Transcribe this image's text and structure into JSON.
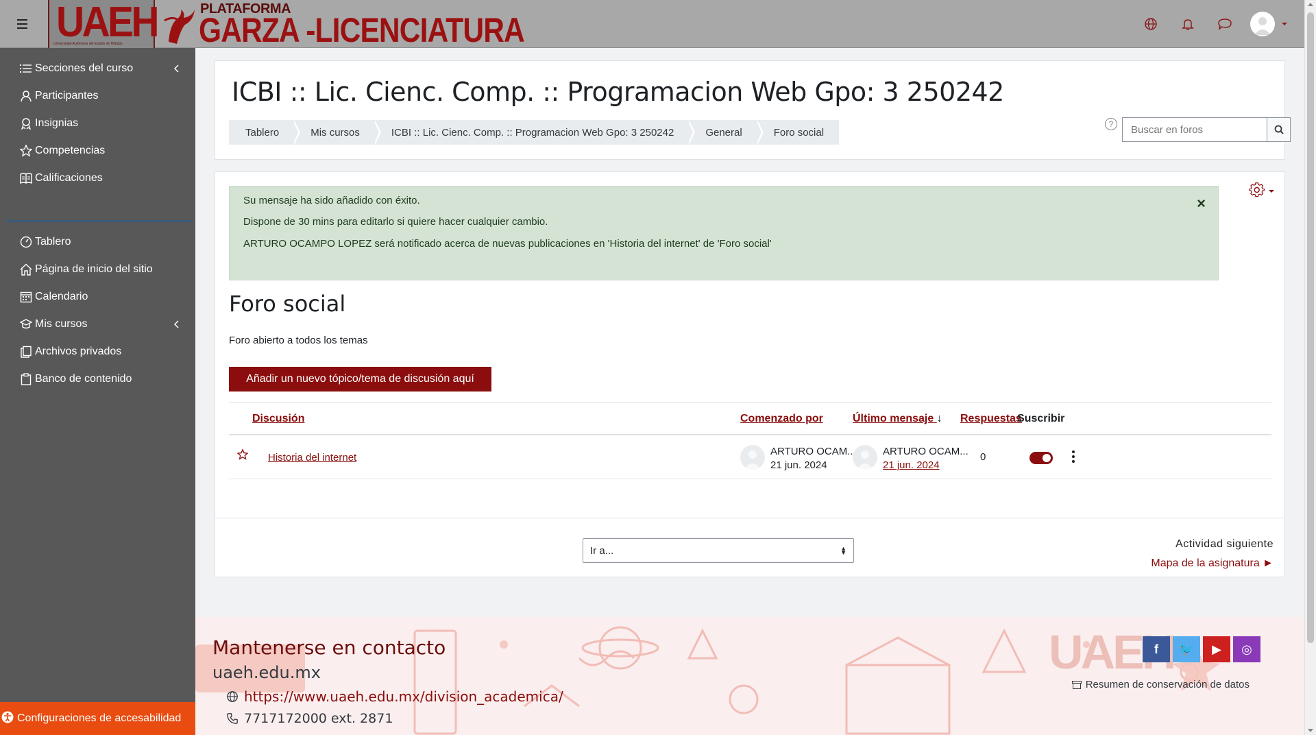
{
  "navbar": {
    "logo_uaeh": "UAEH",
    "logo_uaeh_sub": "Universidad Autónoma del Estado de Hidalgo",
    "logo_platform": "PLATAFORMA",
    "logo_garza": "GARZA -LICENCIATURA",
    "icons": [
      "hamburger-icon",
      "globe-icon",
      "bell-icon",
      "chat-icon",
      "user-avatar"
    ]
  },
  "sidebar": {
    "items": [
      {
        "label": "Secciones del curso",
        "icon": "list-icon",
        "has_chevron": true
      },
      {
        "label": "Participantes",
        "icon": "user-icon"
      },
      {
        "label": "Insignias",
        "icon": "badge-icon"
      },
      {
        "label": "Competencias",
        "icon": "star-icon"
      },
      {
        "label": "Calificaciones",
        "icon": "gradebook-icon"
      },
      {
        "label": "Tablero",
        "icon": "dashboard-icon"
      },
      {
        "label": "Página de inicio del sitio",
        "icon": "home-icon"
      },
      {
        "label": "Calendario",
        "icon": "calendar-icon"
      },
      {
        "label": "Mis cursos",
        "icon": "graduation-cap-icon",
        "has_chevron": true
      },
      {
        "label": "Archivos privados",
        "icon": "files-icon"
      },
      {
        "label": "Banco de contenido",
        "icon": "clipboard-icon"
      }
    ],
    "accessibility": "Configuraciones de accesabilidad"
  },
  "header": {
    "course_title": "ICBI :: Lic. Cienc. Comp. :: Programacion Web Gpo: 3 250242",
    "breadcrumb": [
      "Tablero",
      "Mis cursos",
      "ICBI :: Lic. Cienc. Comp. :: Programacion Web Gpo: 3 250242",
      "General",
      "Foro social"
    ],
    "search_placeholder": "Buscar en foros",
    "help": "?"
  },
  "alert": {
    "line1": "Su mensaje ha sido añadido con éxito.",
    "line2": "Dispone de 30 mins para editarlo si quiere hacer cualquier cambio.",
    "line3": "ARTURO OCAMPO LOPEZ será notificado acerca de nuevas publicaciones en 'Historia del internet' de 'Foro social'",
    "close": "×"
  },
  "forum": {
    "title": "Foro social",
    "intro": "Foro abierto a todos los temas",
    "add_button": "Añadir un nuevo tópico/tema de discusión aquí",
    "columns": {
      "discussion": "Discusión",
      "started_by": "Comenzado por",
      "last_post": "Último mensaje",
      "last_post_sort": "↓",
      "replies": "Respuestas",
      "subscribe": "Suscribir"
    },
    "rows": [
      {
        "topic": "Historia del internet",
        "starter_name": "ARTURO OCAM...",
        "starter_date": "21 jun. 2024",
        "last_name": "ARTURO OCAM...",
        "last_date": "21 jun. 2024",
        "replies": "0",
        "subscribed": true
      }
    ]
  },
  "nav_footer": {
    "jump_placeholder": "Ir a...",
    "next_label": "Actividad siguiente",
    "next_link": "Mapa de la asignatura ►"
  },
  "site_footer": {
    "title": "Mantenerse en contacto",
    "domain": "uaeh.edu.mx",
    "url": "https://www.uaeh.edu.mx/division_academica/",
    "phone": "7717172000 ext. 2871",
    "retention": "Resumen de conservación de datos",
    "socials": [
      {
        "name": "facebook-icon",
        "glyph": "f",
        "color": "#3b5998"
      },
      {
        "name": "twitter-icon",
        "glyph": "🐦",
        "color": "#55acee"
      },
      {
        "name": "youtube-icon",
        "glyph": "▶",
        "color": "#cd201f"
      },
      {
        "name": "instagram-icon",
        "glyph": "◎",
        "color": "#8a3ab9"
      }
    ]
  },
  "colors": {
    "accent": "#8b0d0d",
    "sidebar": "#585858",
    "navbar": "#a8a8a8",
    "alert_bg": "#d4e3d4",
    "accessibility": "#e84c10"
  }
}
